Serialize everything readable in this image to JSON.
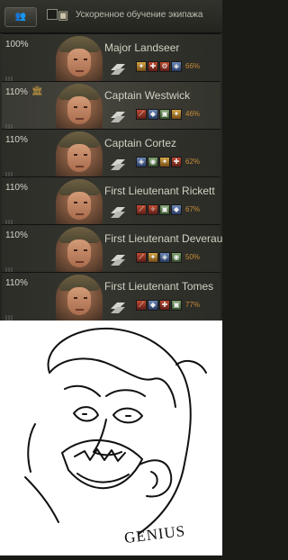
{
  "top_bar": {
    "crew_button": "👥",
    "accelerated_training_label": "Ускоренное обучение экипажа",
    "checkbox_checked": false,
    "book_icon": "book-icon"
  },
  "crew": [
    {
      "percent": "100%",
      "extra": "",
      "name": "Major Landseer",
      "training": "66%",
      "skills": [
        {
          "type": "gold",
          "glyph": "✦"
        },
        {
          "type": "red",
          "glyph": "✚"
        },
        {
          "type": "red",
          "glyph": "⚙"
        },
        {
          "type": "blue",
          "glyph": "◈"
        }
      ]
    },
    {
      "percent": "110%",
      "extra": "🏛",
      "name": "Captain Westwick",
      "training": "46%",
      "skills": [
        {
          "type": "red",
          "glyph": "⟋"
        },
        {
          "type": "blue",
          "glyph": "◆"
        },
        {
          "type": "green",
          "glyph": "▣"
        },
        {
          "type": "gold",
          "glyph": "✦"
        }
      ]
    },
    {
      "percent": "110%",
      "extra": "",
      "name": "Captain Cortez",
      "training": "62%",
      "skills": [
        {
          "type": "blue",
          "glyph": "◈"
        },
        {
          "type": "green",
          "glyph": "◉"
        },
        {
          "type": "gold",
          "glyph": "✦"
        },
        {
          "type": "red",
          "glyph": "✚"
        }
      ]
    },
    {
      "percent": "110%",
      "extra": "",
      "name": "First Lieutenant Rickett",
      "training": "67%",
      "skills": [
        {
          "type": "red",
          "glyph": "⟋"
        },
        {
          "type": "red",
          "glyph": "✧"
        },
        {
          "type": "green",
          "glyph": "▣"
        },
        {
          "type": "blue",
          "glyph": "◆"
        }
      ]
    },
    {
      "percent": "110%",
      "extra": "",
      "name": "First Lieutenant Deveraux",
      "training": "50%",
      "skills": [
        {
          "type": "red",
          "glyph": "⟋"
        },
        {
          "type": "gold",
          "glyph": "✦"
        },
        {
          "type": "blue",
          "glyph": "◈"
        },
        {
          "type": "green",
          "glyph": "◉"
        }
      ]
    },
    {
      "percent": "110%",
      "extra": "",
      "name": "First Lieutenant Tomes",
      "training": "77%",
      "skills": [
        {
          "type": "red",
          "glyph": "⟋"
        },
        {
          "type": "blue",
          "glyph": "◆"
        },
        {
          "type": "red",
          "glyph": "✚"
        },
        {
          "type": "green",
          "glyph": "▣"
        }
      ]
    }
  ],
  "meme": {
    "caption": "GENIUS"
  }
}
